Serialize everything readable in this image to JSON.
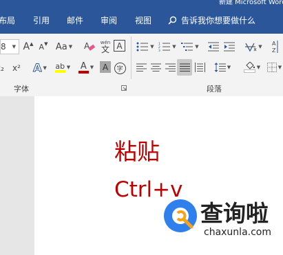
{
  "window": {
    "title_fragment": "新建 Microsoft Word"
  },
  "tabs": [
    {
      "label": "布局"
    },
    {
      "label": "引用"
    },
    {
      "label": "邮件"
    },
    {
      "label": "审阅"
    },
    {
      "label": "视图"
    }
  ],
  "tellme": {
    "placeholder": "告诉我你想要做什么"
  },
  "font_group": {
    "label": "字体",
    "size_fragment": "8",
    "grow_glyph": "A",
    "shrink_glyph": "A",
    "case_glyph": "Aa",
    "phonetic_top": "wén",
    "phonetic_bottom": "文",
    "border_char": "A",
    "subscript_glyph": "x₂",
    "superscript_glyph": "x²",
    "effects_glyph": "A",
    "highlight_glyph": "ab",
    "font_color_glyph": "A",
    "shading_glyph": "A",
    "enclose_glyph": "字"
  },
  "paragraph_group": {
    "label": "段落"
  },
  "document": {
    "line1": "粘贴",
    "line2": "Ctrl+v"
  },
  "watermark": {
    "name": "查询啦",
    "domain": "chaxunla.com"
  },
  "colors": {
    "ribbon_blue": "#2b579a",
    "doc_text_red": "#c00000",
    "font_color_underline": "#c00000",
    "highlight_yellow": "#ffff00",
    "watermark_blue": "#2f80ed",
    "watermark_orange": "#f7a21b"
  }
}
